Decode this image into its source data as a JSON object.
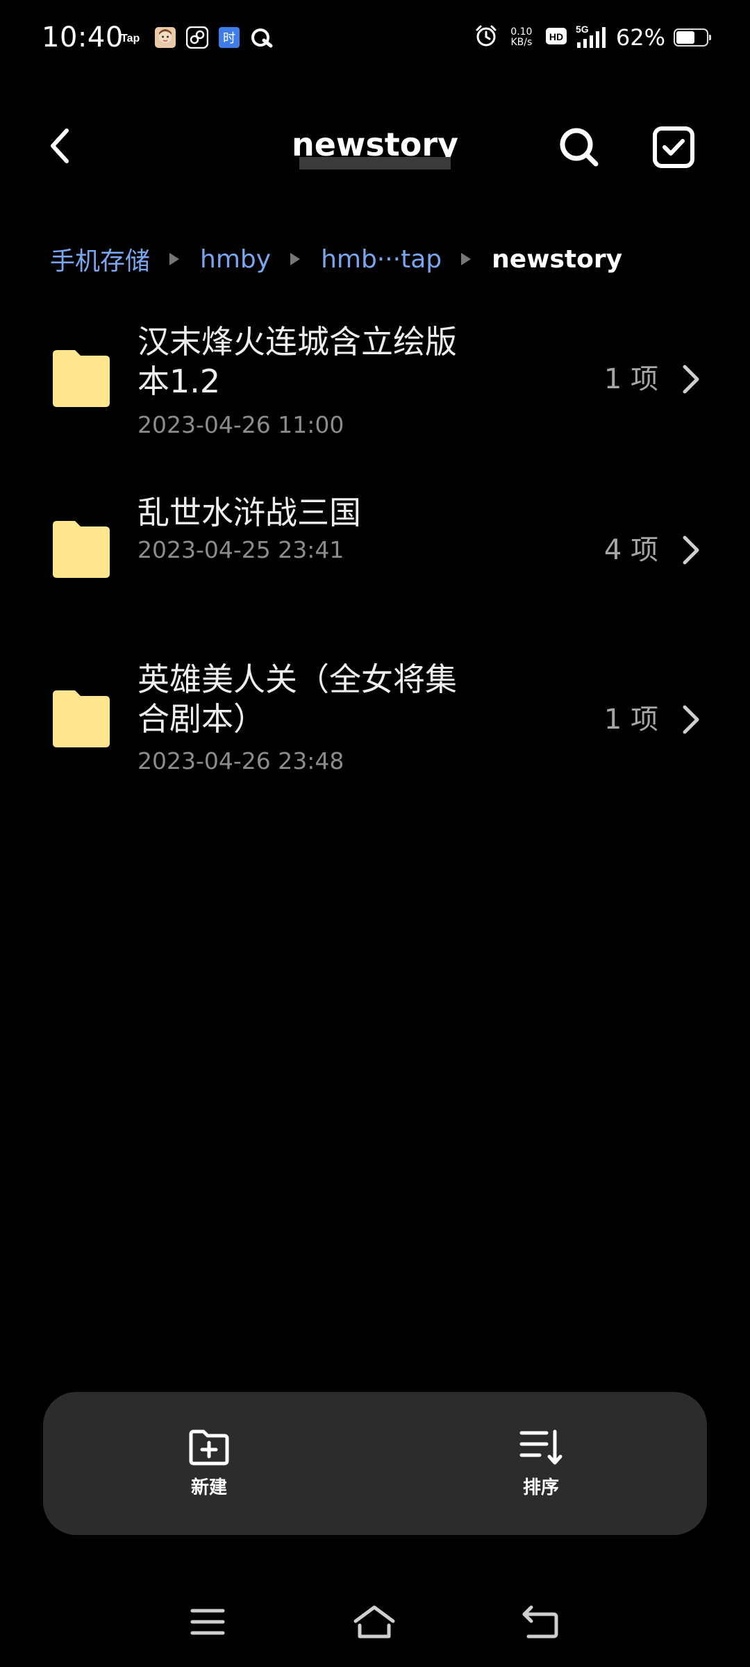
{
  "status_bar": {
    "time": "10:40",
    "notification_icons": [
      "taptap-icon",
      "avatar-app-icon",
      "game-app-icon",
      "time-app-icon",
      "q-app-icon"
    ],
    "tap_label": "Tap",
    "time_app_label": "时",
    "net_speed_value": "0.10",
    "net_speed_unit": "KB/s",
    "hd_label": "HD",
    "network_label": "5G",
    "battery_percent": "62%",
    "battery_level": 0.62
  },
  "header": {
    "title": "newstory"
  },
  "breadcrumb": {
    "items": [
      "手机存储",
      "hmby",
      "hmb···tap",
      "newstory"
    ]
  },
  "files": [
    {
      "name": "汉末烽火连城含立绘版本1.2",
      "name_lines": [
        "汉末烽火连城含立绘版",
        "本1.2"
      ],
      "date": "2023-04-26 11:00",
      "count": "1 项"
    },
    {
      "name": "乱世水浒战三国",
      "name_lines": [
        "乱世水浒战三国"
      ],
      "date": "2023-04-25 23:41",
      "count": "4 项"
    },
    {
      "name": "英雄美人关（全女将集合剧本）",
      "name_lines": [
        "英雄美人关（全女将集",
        "合剧本）"
      ],
      "date": "2023-04-26 23:48",
      "count": "1 项"
    }
  ],
  "actions": {
    "new_label": "新建",
    "sort_label": "排序"
  },
  "colors": {
    "background": "#000000",
    "folder": "#fde68e",
    "breadcrumb_link": "#7aa6f0",
    "action_bar": "#2c2c2c"
  }
}
